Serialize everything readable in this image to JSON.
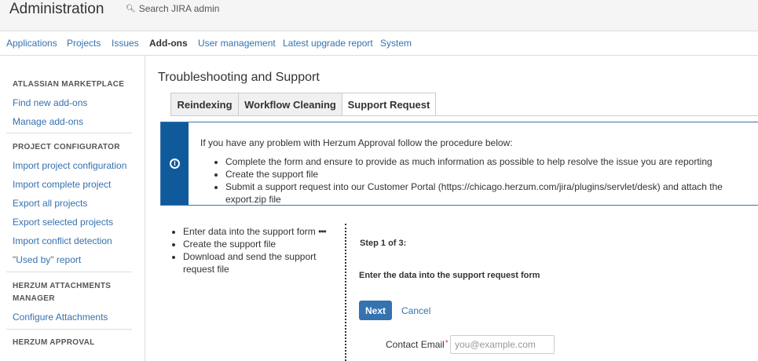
{
  "header": {
    "title": "Administration",
    "search_label": "Search JIRA admin"
  },
  "nav": {
    "items": [
      {
        "label": "Applications"
      },
      {
        "label": "Projects"
      },
      {
        "label": "Issues"
      },
      {
        "label": "Add-ons",
        "active": true
      },
      {
        "label": "User management"
      },
      {
        "label": "Latest upgrade report"
      },
      {
        "label": "System"
      }
    ]
  },
  "sidebar": {
    "sections": [
      {
        "heading": "ATLASSIAN MARKETPLACE",
        "links": [
          "Find new add-ons",
          "Manage add-ons"
        ]
      },
      {
        "heading": "PROJECT CONFIGURATOR",
        "links": [
          "Import project configuration",
          "Import complete project",
          "Export all projects",
          "Export selected projects",
          "Import conflict detection",
          "\"Used by\" report"
        ]
      },
      {
        "heading_line1": "HERZUM ATTACHMENTS",
        "heading_line2": "MANAGER",
        "links": [
          "Configure Attachments"
        ]
      },
      {
        "heading": "HERZUM APPROVAL"
      }
    ]
  },
  "main": {
    "page_title": "Troubleshooting and Support",
    "tabs": [
      {
        "label": "Reindexing"
      },
      {
        "label": "Workflow Cleaning"
      },
      {
        "label": "Support Request",
        "active": true
      }
    ],
    "info": {
      "intro": "If you have any problem with Herzum Approval follow the procedure below:",
      "items": [
        "Complete the form and ensure to provide as much information as possible to help resolve the issue you are reporting",
        "Create the support file",
        "Submit a support request into our Customer Portal (https://chicago.herzum.com/jira/plugins/servlet/desk) and attach the export.zip file"
      ]
    },
    "steps": {
      "step1": "Enter data into the support form",
      "step1_suffix": "•••",
      "step2": "Create the support file",
      "step3": "Download and send the support request file"
    },
    "form": {
      "step_number": "Step 1 of 3:",
      "step_description": "Enter the data into the support request form",
      "next_label": "Next",
      "cancel_label": "Cancel",
      "email_label": "Contact Email",
      "email_required": "*",
      "email_placeholder": "you@example.com",
      "email_value": ""
    }
  },
  "colors": {
    "link": "#3572b0",
    "info_band": "#0f5a9a",
    "primary_button": "#3572b0",
    "required": "#d04437"
  },
  "icons": {
    "search": "search-icon",
    "info": "info-icon"
  }
}
